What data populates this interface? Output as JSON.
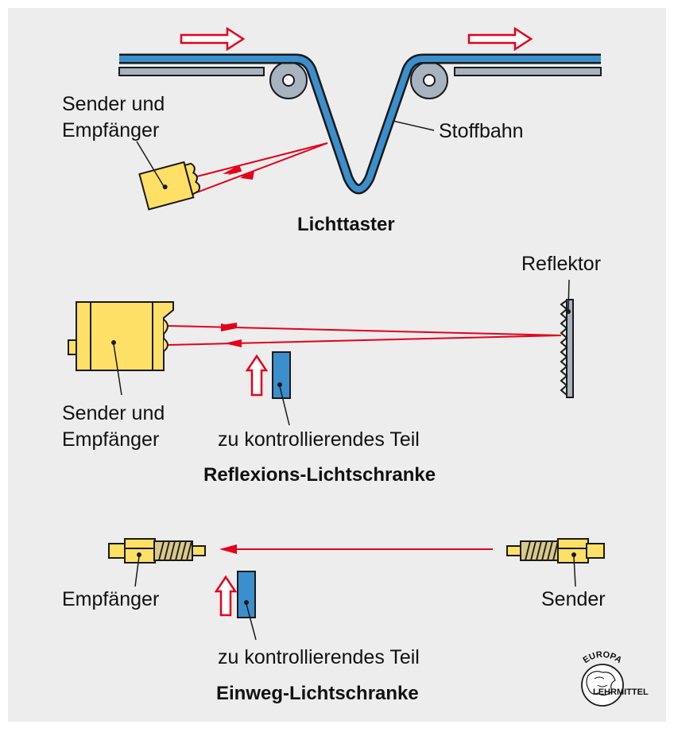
{
  "colors": {
    "background": "#ededed",
    "web_blue": "#3a8fcc",
    "sensor_yellow": "#ffe066",
    "beam_red": "#e3001b",
    "rail_gray": "#a8b3c0",
    "part_blue": "#3a8fcc"
  },
  "icons": {
    "flow_arrow": "hollow-red-arrow-right",
    "move_arrow": "hollow-red-arrow-up",
    "logo": "europa-lehrmittel-globe"
  },
  "sections": {
    "lichttaster": {
      "title": "Lichttaster",
      "sensor_label_line1": "Sender und",
      "sensor_label_line2": "Empfänger",
      "web_label": "Stoffbahn"
    },
    "reflexion": {
      "title": "Reflexions-Lichtschranke",
      "sensor_label_line1": "Sender und",
      "sensor_label_line2": "Empfänger",
      "reflector_label": "Reflektor",
      "part_label": "zu kontrollierendes Teil"
    },
    "einweg": {
      "title": "Einweg-Lichtschranke",
      "receiver_label": "Empfänger",
      "sender_label": "Sender",
      "part_label": "zu kontrollierendes Teil"
    }
  },
  "logo": {
    "top_text": "EUROPA",
    "bottom_text": "LEHRMITTEL"
  }
}
